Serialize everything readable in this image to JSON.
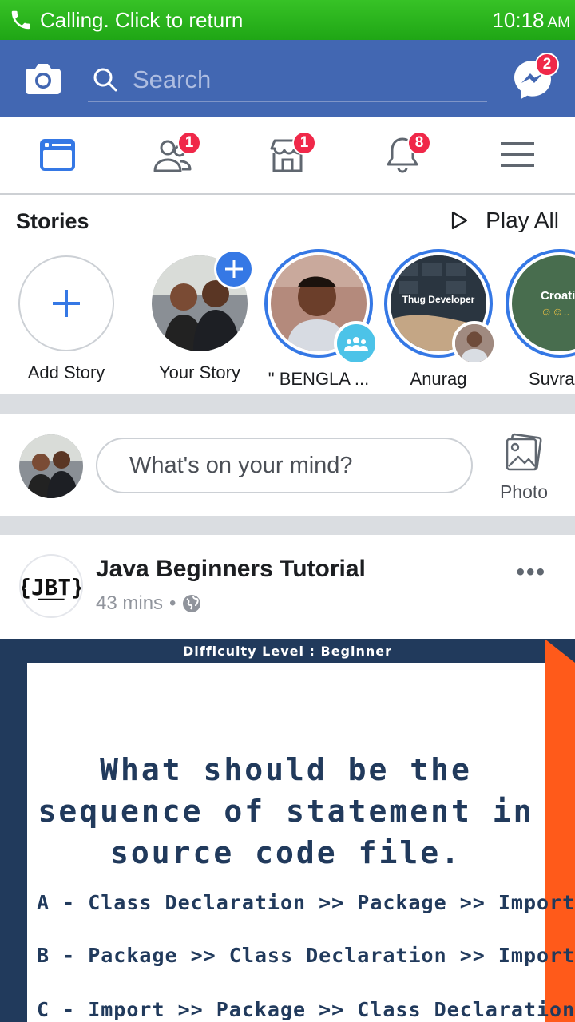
{
  "status_bar": {
    "call_text": "Calling. Click to return",
    "time": "10:18",
    "ampm": "AM"
  },
  "header": {
    "search_placeholder": "Search",
    "messenger_badge": "2"
  },
  "nav": {
    "friends_badge": "1",
    "marketplace_badge": "1",
    "notifications_badge": "8"
  },
  "stories": {
    "title": "Stories",
    "play_all": "Play All",
    "items": [
      {
        "label": "Add Story"
      },
      {
        "label": "Your Story"
      },
      {
        "label": "\" BENGLA ..."
      },
      {
        "label": "Anurag",
        "thumb_text": "Thug Developer"
      },
      {
        "label": "Suvran",
        "thumb_text": "Croatia"
      }
    ]
  },
  "composer": {
    "placeholder": "What's on your mind?",
    "photo_label": "Photo"
  },
  "post": {
    "author": "Java Beginners Tutorial",
    "time": "43 mins",
    "separator": "•",
    "logo_text": "{JBT}",
    "image": {
      "difficulty": "Difficulty Level : Beginner",
      "question_lines": [
        "What should be the",
        "sequence of statement in",
        "source code file."
      ],
      "options": [
        "A - Class Declaration >> Package >> Import",
        "B - Package >> Class Declaration >> Import",
        "C - Import >> Package >> Class Declaration"
      ]
    }
  },
  "colors": {
    "fb_blue": "#4267b2",
    "accent_blue": "#3578e5",
    "badge_red": "#f02849",
    "status_green": "#22a817"
  }
}
